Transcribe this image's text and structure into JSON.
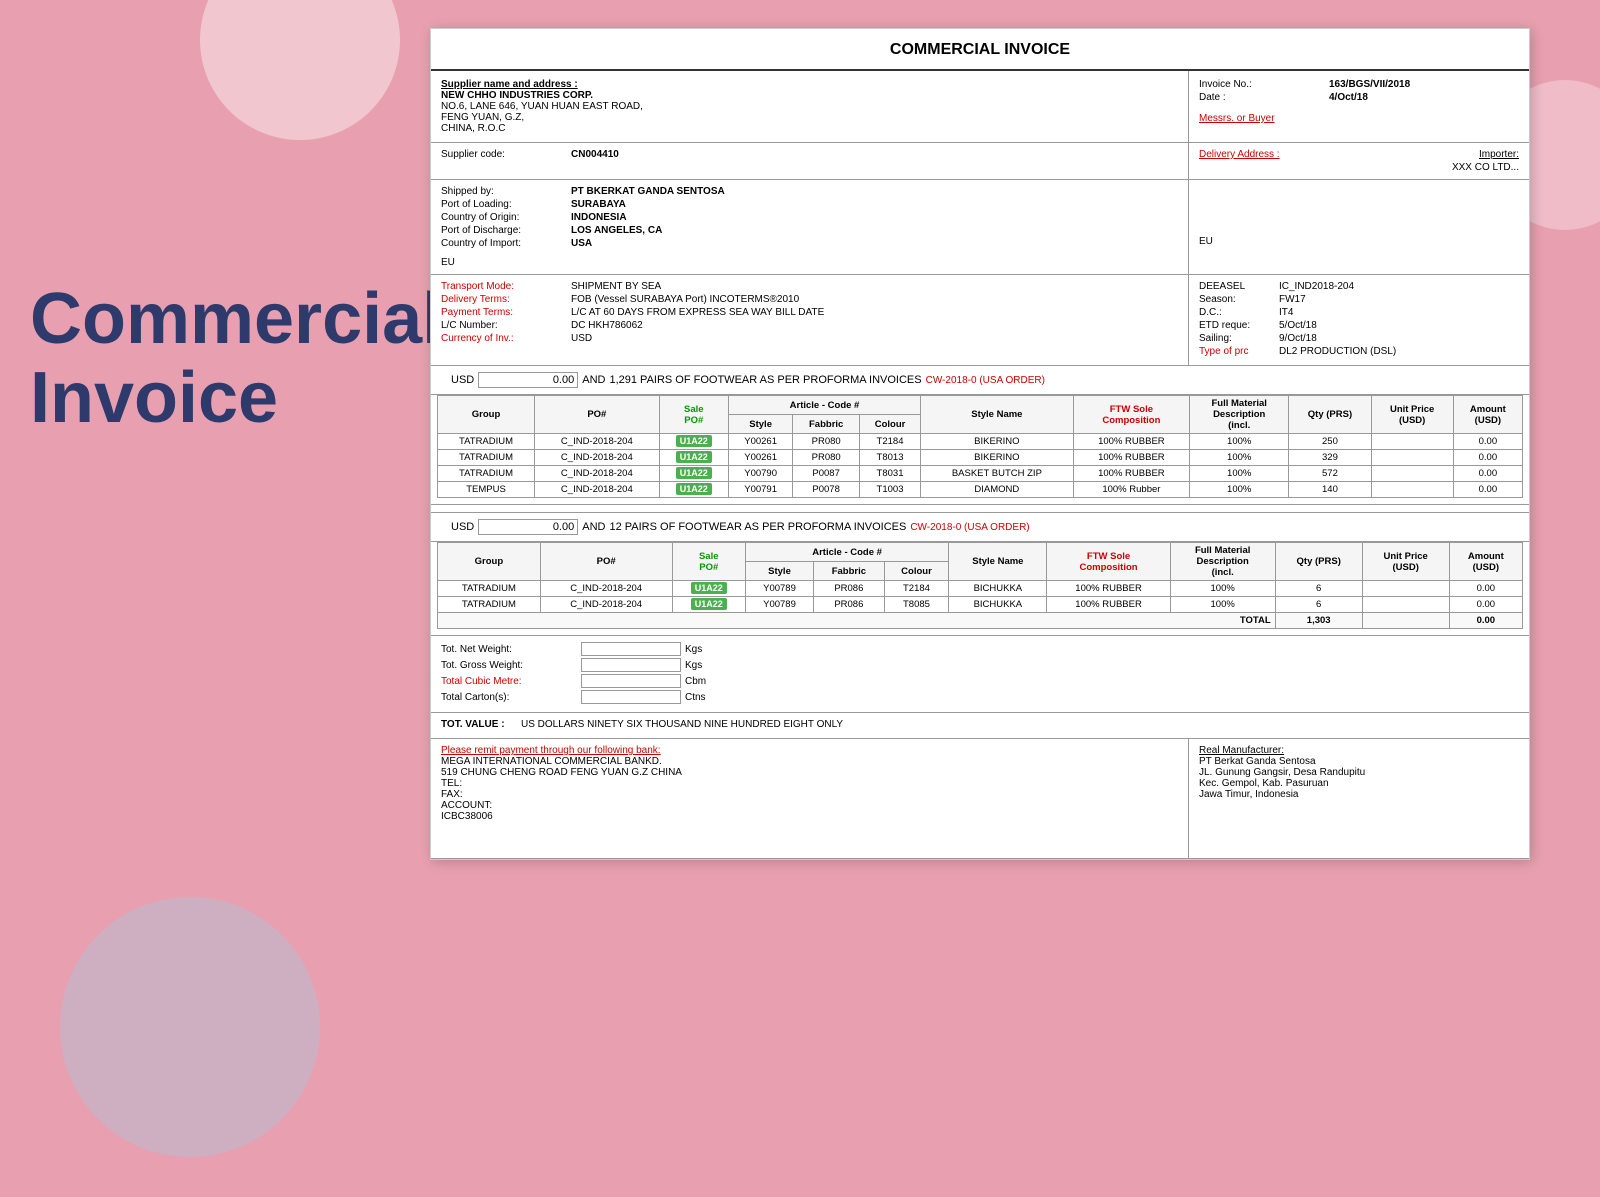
{
  "page": {
    "bg_title_line1": "Commercial",
    "bg_title_line2": "Invoice"
  },
  "invoice": {
    "title": "COMMERCIAL INVOICE",
    "supplier_label": "Supplier name and address :",
    "supplier_name": "NEW CHHO INDUSTRIES CORP.",
    "supplier_address1": "NO.6, LANE 646, YUAN HUAN EAST ROAD,",
    "supplier_address2": "FENG YUAN, G.Z,",
    "supplier_address3": "CHINA, R.O.C",
    "invoice_no_label": "Invoice No.:",
    "invoice_no": "163/BGS/VII/2018",
    "date_label": "Date       :",
    "date_value": "4/Oct/18",
    "buyer_label": "Messrs. or Buyer",
    "supplier_code_label": "Supplier code:",
    "supplier_code": "CN004410",
    "delivery_address_label": "Delivery Address :",
    "importer_label": "Importer:",
    "importer_value": "XXX CO LTD...",
    "shipped_by_label": "Shipped by:",
    "shipped_by": "PT BKERKAT GANDA SENTOSA",
    "port_loading_label": "Port of Loading:",
    "port_loading": "SURABAYA",
    "country_origin_label": "Country of Origin:",
    "country_origin": "INDONESIA",
    "port_discharge_label": "Port of Discharge:",
    "port_discharge": "LOS ANGELES, CA",
    "country_import_label": "Country of Import:",
    "country_import": "USA",
    "eu_left": "EU",
    "eu_right": "EU",
    "transport_mode_label": "Transport Mode:",
    "transport_mode": "SHIPMENT BY SEA",
    "delivery_terms_label": "Delivery Terms:",
    "delivery_terms": "FOB (Vessel SURABAYA Port) INCOTERMS®2010",
    "payment_terms_label": "Payment Terms:",
    "payment_terms": "L/C AT 60 DAYS FROM EXPRESS SEA WAY BILL  DATE",
    "lc_number_label": "L/C Number:",
    "lc_number": "DC HKH786062",
    "currency_label": "Currency of Inv.:",
    "currency": "USD",
    "deasel_label": "DEEASEL",
    "deasel_value": "IC_IND2018-204",
    "season_label": "Season:",
    "season_value": "FW17",
    "dc_label": "D.C.:",
    "dc_value": "IT4",
    "etd_label": "ETD reque:",
    "etd_value": "5/Oct/18",
    "sailing_label": "Sailing:",
    "sailing_value": "9/Oct/18",
    "type_prc_label": "Type of prc",
    "type_prc_value": "DL2  PRODUCTION (DSL)",
    "usd_label1": "USD",
    "usd_amount1": "0.00",
    "and_label1": "AND",
    "pairs_text1": "1,291 PAIRS OF FOOTWEAR AS PER PROFORMA INVOICES",
    "cw_ref1": "CW-2018-0 (USA ORDER)",
    "table1_headers": {
      "group": "Group",
      "po": "PO#",
      "sale_po": "Sale PO#",
      "article_code": "Article - Code #",
      "style": "Style",
      "fabbric": "Fabbric",
      "colour": "Colour",
      "style_name": "Style Name",
      "ftw_sole": "FTW Sole Composition",
      "full_material": "Full Material Description (incl.",
      "qty": "Qty (PRS)",
      "unit_price": "Unit Price (USD)",
      "amount": "Amount (USD)"
    },
    "table1_rows": [
      {
        "group": "TATRADIUM",
        "po": "C_IND-2018-204",
        "sale_po": "U1A22",
        "style": "Y00261",
        "fabbric": "PR080",
        "colour": "T2184",
        "style_name": "BIKERINO",
        "ftw": "100% RUBBER",
        "full_material": "100%",
        "qty": "250",
        "unit_price": "",
        "amount": "0.00"
      },
      {
        "group": "TATRADIUM",
        "po": "C_IND-2018-204",
        "sale_po": "U1A22",
        "style": "Y00261",
        "fabbric": "PR080",
        "colour": "T8013",
        "style_name": "BIKERINO",
        "ftw": "100% RUBBER",
        "full_material": "100%",
        "qty": "329",
        "unit_price": "",
        "amount": "0.00"
      },
      {
        "group": "TATRADIUM",
        "po": "C_IND-2018-204",
        "sale_po": "U1A22",
        "style": "Y00790",
        "fabbric": "P0087",
        "colour": "T8031",
        "style_name": "BASKET BUTCH ZIP",
        "ftw": "100% RUBBER",
        "full_material": "100%",
        "qty": "572",
        "unit_price": "",
        "amount": "0.00"
      },
      {
        "group": "TEMPUS",
        "po": "C_IND-2018-204",
        "sale_po": "U1A22",
        "style": "Y00791",
        "fabbric": "P0078",
        "colour": "T1003",
        "style_name": "DIAMOND",
        "ftw": "100% Rubber",
        "full_material": "100%",
        "qty": "140",
        "unit_price": "",
        "amount": "0.00"
      }
    ],
    "usd_label2": "USD",
    "usd_amount2": "0.00",
    "and_label2": "AND",
    "pairs_text2": "12 PAIRS OF FOOTWEAR AS PER PROFORMA INVOICES",
    "cw_ref2": "CW-2018-0 (USA ORDER)",
    "table2_rows": [
      {
        "group": "TATRADIUM",
        "po": "C_IND-2018-204",
        "sale_po": "U1A22",
        "style": "Y00789",
        "fabbric": "PR086",
        "colour": "T2184",
        "style_name": "BICHUKKA",
        "ftw": "100% RUBBER",
        "full_material": "100%",
        "qty": "6",
        "unit_price": "",
        "amount": "0.00"
      },
      {
        "group": "TATRADIUM",
        "po": "C_IND-2018-204",
        "sale_po": "U1A22",
        "style": "Y00789",
        "fabbric": "PR086",
        "colour": "T8085",
        "style_name": "BICHUKKA",
        "ftw": "100% RUBBER",
        "full_material": "100%",
        "qty": "6",
        "unit_price": "",
        "amount": "0.00"
      }
    ],
    "total_label": "TOTAL",
    "total_qty": "1,303",
    "total_amount": "0.00",
    "net_weight_label": "Tot. Net Weight:",
    "gross_weight_label": "Tot. Gross Weight:",
    "cubic_label": "Total Cubic Metre:",
    "carton_label": "Total Carton(s):",
    "kgs": "Kgs",
    "kgs2": "Kgs",
    "cbm": "Cbm",
    "ctns": "Ctns",
    "tot_value_label": "TOT. VALUE :",
    "tot_value_text": "US DOLLARS NINETY SIX THOUSAND NINE HUNDRED EIGHT ONLY",
    "bank_remit_label": "Please remit payment  through our following bank:",
    "bank_name": "MEGA INTERNATIONAL  COMMERCIAL  BANKD.",
    "bank_address1": "519 CHUNG CHENG ROAD FENG YUAN G.Z CHINA",
    "tel_label": "TEL:",
    "fax_label": "FAX:",
    "account_label": "ACCOUNT:",
    "icbc_label": "ICBC38006",
    "real_mfr_label": "Real Manufacturer:",
    "real_mfr_name": "PT Berkat Ganda Sentosa",
    "real_mfr_addr1": "JL. Gunung Gangsir, Desa Randupitu",
    "real_mfr_addr2": "Kec. Gempol, Kab. Pasuruan",
    "real_mfr_addr3": "Jawa Timur, Indonesia"
  }
}
